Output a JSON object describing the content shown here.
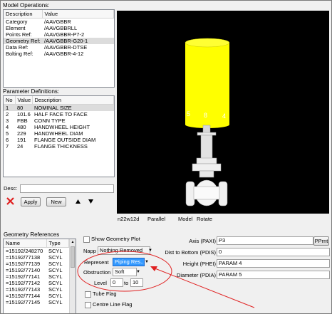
{
  "model_operations": {
    "title": "Model Operations:",
    "headers": [
      "Description",
      "Value"
    ],
    "rows": [
      {
        "description": "Category",
        "value": "/AAVGBBR"
      },
      {
        "description": "Element",
        "value": "/AAVGBBRLL"
      },
      {
        "description": "Points Ref:",
        "value": "/AAVGBBR-P7-2"
      },
      {
        "description": "Geometry Ref:",
        "value": "/AAVGBBR-G20-1"
      },
      {
        "description": "Data Ref:",
        "value": "/AAVGBBR-DTSE"
      },
      {
        "description": "Bolting Ref:",
        "value": "/AAVGBBR-4-12"
      }
    ],
    "selected_row": 3
  },
  "parameter_definitions": {
    "title": "Parameter Definitions:",
    "headers": [
      "No",
      "Value",
      "Description"
    ],
    "rows": [
      {
        "no": "1",
        "value": "80",
        "description": "NOMINAL SIZE"
      },
      {
        "no": "2",
        "value": "101.6",
        "description": "HALF FACE TO FACE"
      },
      {
        "no": "3",
        "value": "FBB",
        "description": "CONN TYPE"
      },
      {
        "no": "4",
        "value": "480",
        "description": "HANDWHEEL HEIGHT"
      },
      {
        "no": "5",
        "value": "229",
        "description": "HANDWHEEL DIAM"
      },
      {
        "no": "6",
        "value": "191",
        "description": "FLANGE OUTSIDE DIAM"
      },
      {
        "no": "7",
        "value": "24",
        "description": "FLANGE THICKNESS"
      }
    ],
    "selected_row": 0
  },
  "desc": {
    "label": "Desc:",
    "value": ""
  },
  "actions": {
    "apply": "Apply",
    "new": "New"
  },
  "viewport": {
    "status_items": [
      "n22w12d",
      "Parallel",
      "Model",
      "Rotate"
    ],
    "point_labels": [
      "5",
      "8",
      "4"
    ],
    "cylinder_color": "#ffff00"
  },
  "geometry_references": {
    "title": "Geometry References",
    "headers": [
      "Name",
      "Type"
    ],
    "rows": [
      {
        "name": "=15192/248270",
        "type": "SCYL"
      },
      {
        "name": "=15192/77138",
        "type": "SCYL"
      },
      {
        "name": "=15192/77139",
        "type": "SCYL"
      },
      {
        "name": "=15192/77140",
        "type": "SCYL"
      },
      {
        "name": "=15192/77141",
        "type": "SCYL"
      },
      {
        "name": "=15192/77142",
        "type": "SCYL"
      },
      {
        "name": "=15192/77143",
        "type": "SCYL"
      },
      {
        "name": "=15192/77144",
        "type": "SCYL"
      },
      {
        "name": "=15192/77145",
        "type": "SCYL"
      }
    ]
  },
  "geometry_options": {
    "show_geometry_plot": "Show Geometry Plot",
    "napp_label": "Napp",
    "napp_value": "Nothing Removed",
    "represent_label": "Represent",
    "represent_value": "Piping Res...",
    "obstruction_label": "Obstruction",
    "obstruction_value": "Soft",
    "level_label": "Level",
    "level_from": "0",
    "level_to_label": "to",
    "level_to": "10",
    "tube_flag": "Tube Flag",
    "centre_line_flag": "Centre Line Flag"
  },
  "parameters": {
    "axis_label": "Axis (PAXI)",
    "axis_value": "P3",
    "pprnt_button": "PPrnt",
    "dist_label": "Dist to Bottom (PDIS)",
    "dist_value": "0",
    "height_label": "Height (PHEI)",
    "height_value": "PARAM 4",
    "diameter_label": "Diameter (PDIA)",
    "diameter_value": "PARAM 5"
  },
  "colors": {
    "annotation": "#e02020",
    "selection": "#3399ff"
  }
}
